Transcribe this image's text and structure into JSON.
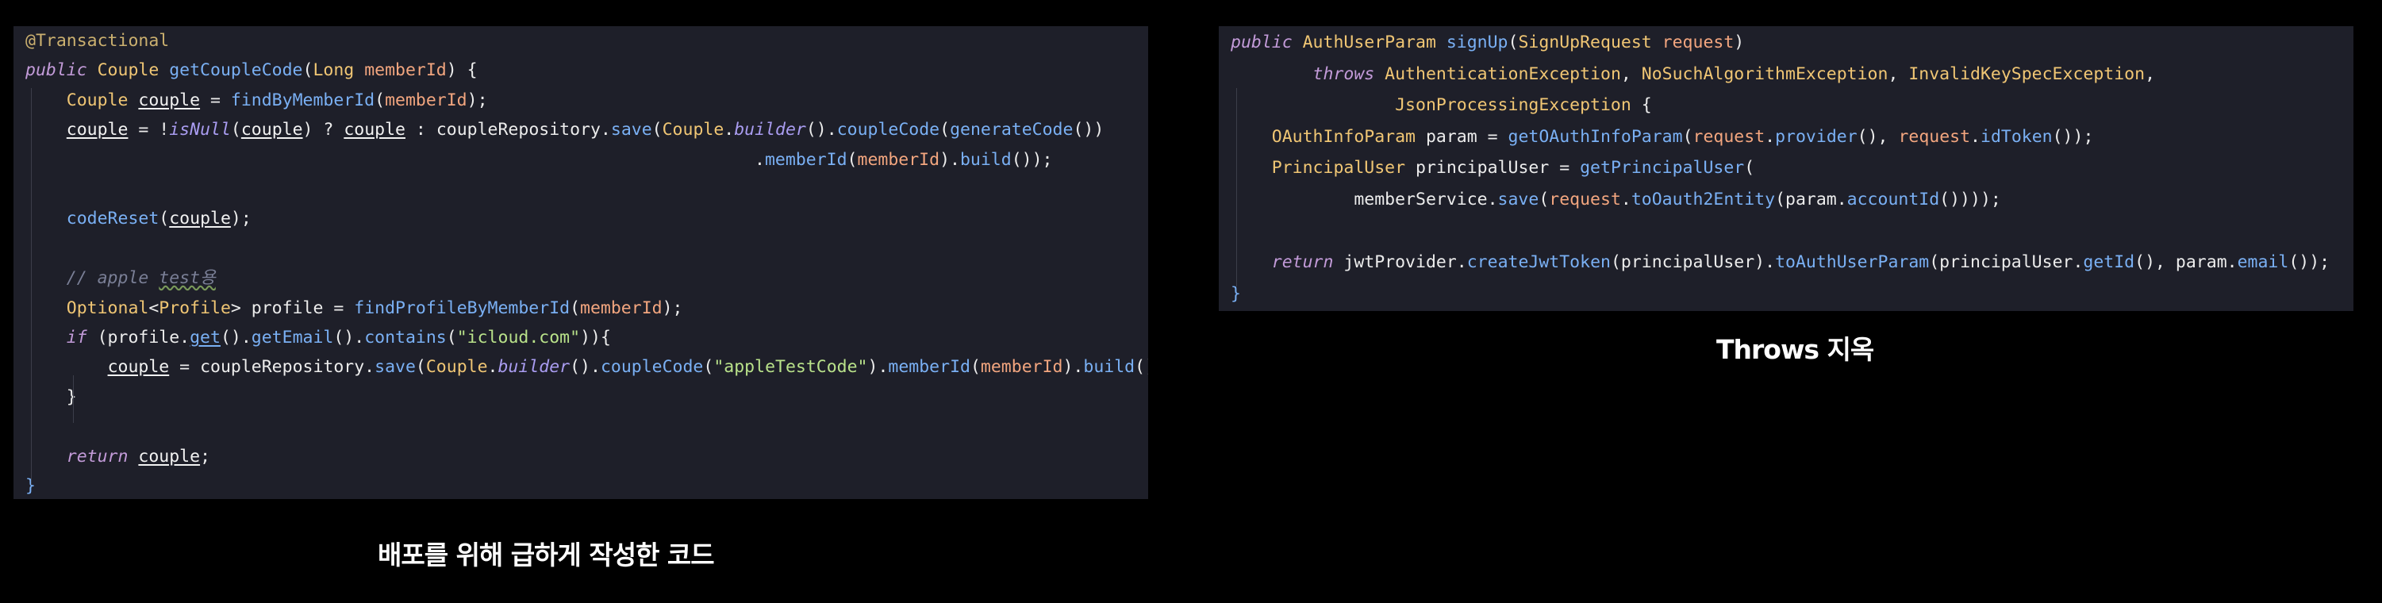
{
  "left_panel": {
    "caption": "배포를 위해 급하게 작성한 코드",
    "lines": [
      [
        {
          "t": "@Transactional",
          "c": "annotation"
        }
      ],
      [
        {
          "t": "public ",
          "c": "keyword"
        },
        {
          "t": "Couple ",
          "c": "type"
        },
        {
          "t": "getCoupleCode",
          "c": "method"
        },
        {
          "t": "(",
          "c": "plain"
        },
        {
          "t": "Long ",
          "c": "type"
        },
        {
          "t": "memberId",
          "c": "param"
        },
        {
          "t": ") {",
          "c": "plain"
        }
      ],
      [
        {
          "t": "    Couple ",
          "c": "type"
        },
        {
          "t": "couple",
          "c": "var"
        },
        {
          "t": " = ",
          "c": "plain"
        },
        {
          "t": "findByMemberId",
          "c": "method"
        },
        {
          "t": "(",
          "c": "plain"
        },
        {
          "t": "memberId",
          "c": "param"
        },
        {
          "t": ");",
          "c": "plain"
        }
      ],
      [
        {
          "t": "    ",
          "c": "plain"
        },
        {
          "t": "couple",
          "c": "var"
        },
        {
          "t": " = !",
          "c": "plain"
        },
        {
          "t": "isNull",
          "c": "static"
        },
        {
          "t": "(",
          "c": "plain"
        },
        {
          "t": "couple",
          "c": "var"
        },
        {
          "t": ") ? ",
          "c": "plain"
        },
        {
          "t": "couple",
          "c": "var"
        },
        {
          "t": " : coupleRepository.",
          "c": "plain"
        },
        {
          "t": "save",
          "c": "method"
        },
        {
          "t": "(",
          "c": "plain"
        },
        {
          "t": "Couple",
          "c": "type"
        },
        {
          "t": ".",
          "c": "plain"
        },
        {
          "t": "builder",
          "c": "static"
        },
        {
          "t": "().",
          "c": "plain"
        },
        {
          "t": "coupleCode",
          "c": "method"
        },
        {
          "t": "(",
          "c": "plain"
        },
        {
          "t": "generateCode",
          "c": "method"
        },
        {
          "t": "())",
          "c": "plain"
        }
      ],
      [
        {
          "t": "                                                                       .",
          "c": "plain"
        },
        {
          "t": "memberId",
          "c": "method"
        },
        {
          "t": "(",
          "c": "plain"
        },
        {
          "t": "memberId",
          "c": "param"
        },
        {
          "t": ").",
          "c": "plain"
        },
        {
          "t": "build",
          "c": "method"
        },
        {
          "t": "());",
          "c": "plain"
        }
      ],
      [],
      [
        {
          "t": "    ",
          "c": "plain"
        },
        {
          "t": "codeReset",
          "c": "method"
        },
        {
          "t": "(",
          "c": "plain"
        },
        {
          "t": "couple",
          "c": "var"
        },
        {
          "t": ");",
          "c": "plain"
        }
      ],
      [],
      [
        {
          "t": "    // apple ",
          "c": "comment"
        },
        {
          "t": "test용",
          "c": "comment-u"
        }
      ],
      [
        {
          "t": "    Optional",
          "c": "type"
        },
        {
          "t": "<",
          "c": "plain"
        },
        {
          "t": "Profile",
          "c": "type"
        },
        {
          "t": "> profile = ",
          "c": "plain"
        },
        {
          "t": "findProfileByMemberId",
          "c": "method"
        },
        {
          "t": "(",
          "c": "plain"
        },
        {
          "t": "memberId",
          "c": "param"
        },
        {
          "t": ");",
          "c": "plain"
        }
      ],
      [
        {
          "t": "    if ",
          "c": "keyword"
        },
        {
          "t": "(profile.",
          "c": "plain"
        },
        {
          "t": "get",
          "c": "method-u"
        },
        {
          "t": "().",
          "c": "plain"
        },
        {
          "t": "getEmail",
          "c": "method"
        },
        {
          "t": "().",
          "c": "plain"
        },
        {
          "t": "contains",
          "c": "method"
        },
        {
          "t": "(",
          "c": "plain"
        },
        {
          "t": "\"icloud.com\"",
          "c": "string"
        },
        {
          "t": ")){",
          "c": "plain"
        }
      ],
      [
        {
          "t": "        ",
          "c": "plain"
        },
        {
          "t": "couple",
          "c": "var"
        },
        {
          "t": " = coupleRepository.",
          "c": "plain"
        },
        {
          "t": "save",
          "c": "method"
        },
        {
          "t": "(",
          "c": "plain"
        },
        {
          "t": "Couple",
          "c": "type"
        },
        {
          "t": ".",
          "c": "plain"
        },
        {
          "t": "builder",
          "c": "static"
        },
        {
          "t": "().",
          "c": "plain"
        },
        {
          "t": "coupleCode",
          "c": "method"
        },
        {
          "t": "(",
          "c": "plain"
        },
        {
          "t": "\"appleTestCode\"",
          "c": "string"
        },
        {
          "t": ").",
          "c": "plain"
        },
        {
          "t": "memberId",
          "c": "method"
        },
        {
          "t": "(",
          "c": "plain"
        },
        {
          "t": "memberId",
          "c": "param"
        },
        {
          "t": ").",
          "c": "plain"
        },
        {
          "t": "build",
          "c": "method"
        },
        {
          "t": "());",
          "c": "plain"
        }
      ],
      [
        {
          "t": "    }",
          "c": "plain"
        }
      ],
      [],
      [
        {
          "t": "    return ",
          "c": "keyword"
        },
        {
          "t": "couple",
          "c": "var"
        },
        {
          "t": ";",
          "c": "plain"
        }
      ],
      [
        {
          "t": "}",
          "c": "brace"
        }
      ]
    ]
  },
  "right_panel": {
    "caption": "Throws 지옥",
    "lines": [
      [
        {
          "t": "public ",
          "c": "keyword"
        },
        {
          "t": "AuthUserParam ",
          "c": "type"
        },
        {
          "t": "signUp",
          "c": "method"
        },
        {
          "t": "(",
          "c": "plain"
        },
        {
          "t": "SignUpRequest ",
          "c": "type"
        },
        {
          "t": "request",
          "c": "param"
        },
        {
          "t": ")",
          "c": "plain"
        }
      ],
      [
        {
          "t": "        throws ",
          "c": "keyword"
        },
        {
          "t": "AuthenticationException",
          "c": "type"
        },
        {
          "t": ", ",
          "c": "plain"
        },
        {
          "t": "NoSuchAlgorithmException",
          "c": "type"
        },
        {
          "t": ", ",
          "c": "plain"
        },
        {
          "t": "InvalidKeySpecException",
          "c": "type"
        },
        {
          "t": ",",
          "c": "plain"
        }
      ],
      [
        {
          "t": "                ",
          "c": "plain"
        },
        {
          "t": "JsonProcessingException",
          "c": "type"
        },
        {
          "t": " {",
          "c": "plain"
        }
      ],
      [
        {
          "t": "    ",
          "c": "plain"
        },
        {
          "t": "OAuthInfoParam ",
          "c": "type"
        },
        {
          "t": "param = ",
          "c": "plain"
        },
        {
          "t": "getOAuthInfoParam",
          "c": "method"
        },
        {
          "t": "(",
          "c": "plain"
        },
        {
          "t": "request",
          "c": "param"
        },
        {
          "t": ".",
          "c": "plain"
        },
        {
          "t": "provider",
          "c": "method"
        },
        {
          "t": "(), ",
          "c": "plain"
        },
        {
          "t": "request",
          "c": "param"
        },
        {
          "t": ".",
          "c": "plain"
        },
        {
          "t": "idToken",
          "c": "method"
        },
        {
          "t": "());",
          "c": "plain"
        }
      ],
      [
        {
          "t": "    ",
          "c": "plain"
        },
        {
          "t": "PrincipalUser ",
          "c": "type"
        },
        {
          "t": "principalUser = ",
          "c": "plain"
        },
        {
          "t": "getPrincipalUser",
          "c": "method"
        },
        {
          "t": "(",
          "c": "plain"
        }
      ],
      [
        {
          "t": "            memberService.",
          "c": "plain"
        },
        {
          "t": "save",
          "c": "method"
        },
        {
          "t": "(",
          "c": "plain"
        },
        {
          "t": "request",
          "c": "param"
        },
        {
          "t": ".",
          "c": "plain"
        },
        {
          "t": "toOauth2Entity",
          "c": "method"
        },
        {
          "t": "(param.",
          "c": "plain"
        },
        {
          "t": "accountId",
          "c": "method"
        },
        {
          "t": "())));",
          "c": "plain"
        }
      ],
      [],
      [
        {
          "t": "    return ",
          "c": "keyword"
        },
        {
          "t": "jwtProvider.",
          "c": "plain"
        },
        {
          "t": "createJwtToken",
          "c": "method"
        },
        {
          "t": "(principalUser).",
          "c": "plain"
        },
        {
          "t": "toAuthUserParam",
          "c": "method"
        },
        {
          "t": "(principalUser.",
          "c": "plain"
        },
        {
          "t": "getId",
          "c": "method"
        },
        {
          "t": "(), param.",
          "c": "plain"
        },
        {
          "t": "email",
          "c": "method"
        },
        {
          "t": "());",
          "c": "plain"
        }
      ],
      [
        {
          "t": "}",
          "c": "brace"
        }
      ]
    ]
  }
}
